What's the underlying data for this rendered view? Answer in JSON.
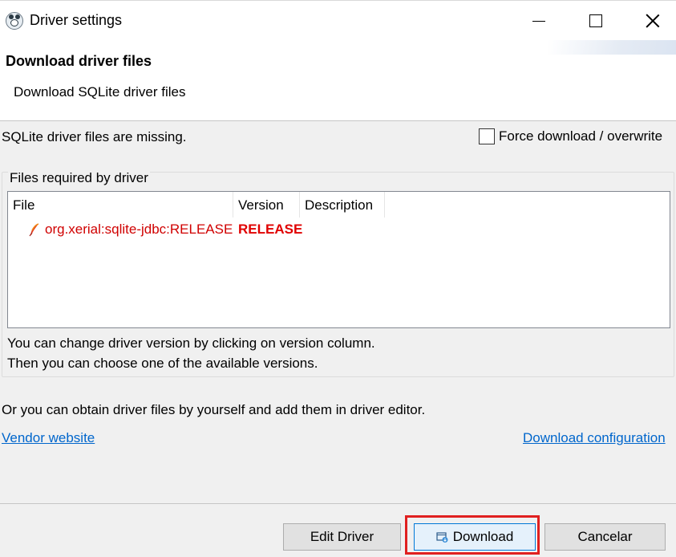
{
  "window": {
    "title": "Driver settings",
    "app_icon": "dbeaver-beaver-icon",
    "controls": [
      "minimize-icon",
      "maximize-icon",
      "close-icon"
    ]
  },
  "header": {
    "title": "Download driver files",
    "subtitle": "Download SQLite driver files"
  },
  "status": {
    "message": "SQLite driver files are missing.",
    "force_label": "Force download / overwrite",
    "force_checked": false
  },
  "files_group": {
    "label": "Files required by driver",
    "columns": [
      "File",
      "Version",
      "Description"
    ],
    "rows": [
      {
        "icon": "feather-icon",
        "file": "org.xerial:sqlite-jdbc:RELEASE",
        "version": "RELEASE",
        "description": ""
      }
    ],
    "hint_line1": "You can change driver version by clicking on version column.",
    "hint_line2": "Then you can choose one of the available versions."
  },
  "obtain_text": "Or you can obtain driver files by yourself and add them in driver editor.",
  "links": {
    "vendor": "Vendor website",
    "config": "Download configuration"
  },
  "buttons": {
    "edit": "Edit Driver",
    "download": "Download",
    "cancel": "Cancelar"
  },
  "colors": {
    "error_text": "#d00000",
    "link": "#0066cc",
    "highlight": "#e02020",
    "default_button_border": "#0078d7"
  }
}
